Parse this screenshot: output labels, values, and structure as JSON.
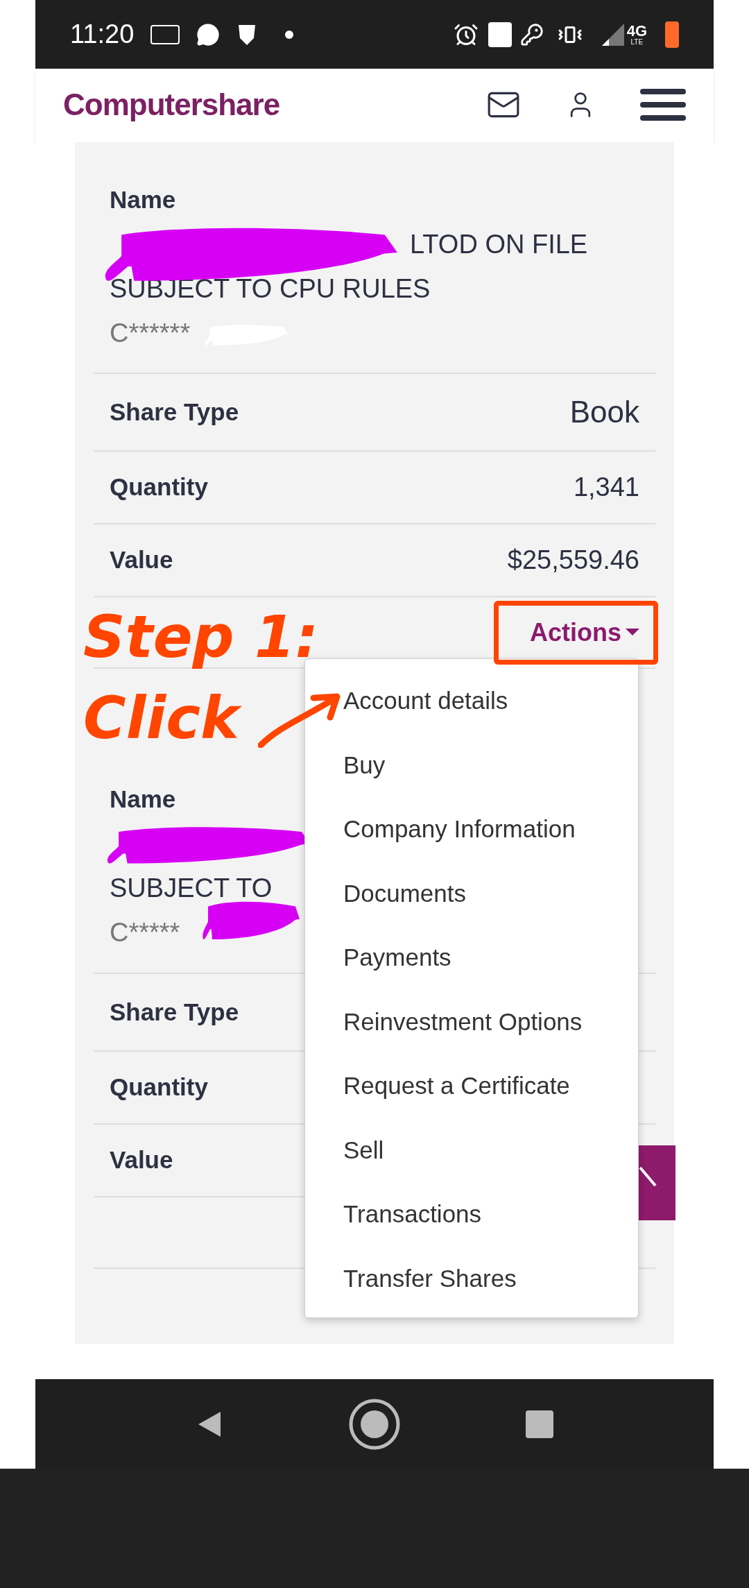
{
  "status_bar": {
    "time": "11:20",
    "network": "4G",
    "network_sub": "LTE"
  },
  "header": {
    "logo": "Computershare"
  },
  "accounts": [
    {
      "name_label": "Name",
      "name_lines": [
        {
          "kind": "partial",
          "text": "LTOD ON FILE"
        },
        {
          "kind": "full",
          "text": "SUBJECT TO CPU RULES"
        }
      ],
      "account_number": "C******",
      "fields": [
        {
          "label": "Share Type",
          "value": "Book"
        },
        {
          "label": "Quantity",
          "value": "1,341"
        },
        {
          "label": "Value",
          "value": "$25,559.46"
        }
      ],
      "actions": "Actions"
    },
    {
      "name_label": "Name",
      "name_lines": [
        {
          "kind": "redacted"
        },
        {
          "kind": "full",
          "text": "SUBJECT TO"
        }
      ],
      "account_number": "C*****",
      "fields": [
        {
          "label": "Share Type"
        },
        {
          "label": "Quantity"
        },
        {
          "label": "Value"
        }
      ]
    }
  ],
  "dropdown": {
    "expanded": true,
    "items": [
      "Account details",
      "Buy",
      "Company Information",
      "Documents",
      "Payments",
      "Reinvestment Options",
      "Request a Certificate",
      "Sell",
      "Transactions",
      "Transfer Shares"
    ]
  },
  "annotation": {
    "lines": [
      "Step 1:",
      "Click"
    ]
  }
}
